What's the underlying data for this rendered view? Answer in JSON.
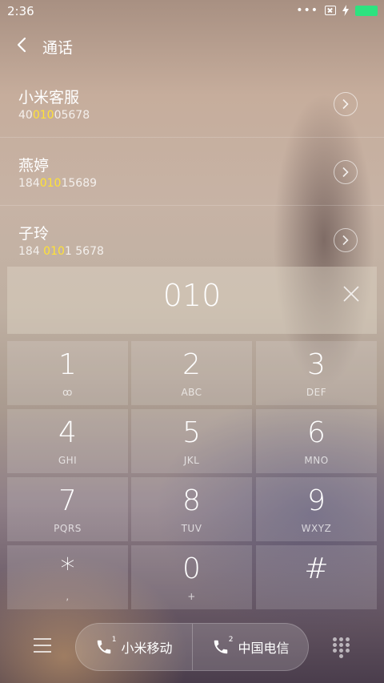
{
  "status": {
    "time": "2:36",
    "dots": "•••"
  },
  "header": {
    "title": "通话"
  },
  "results": [
    {
      "name": "小米客服",
      "number_pre": "40",
      "number_match": "010",
      "number_post": "05678"
    },
    {
      "name": "燕婷",
      "number_pre": "184",
      "number_match": "010",
      "number_post": "15689"
    },
    {
      "name": "子玲",
      "number_pre": "184 ",
      "number_match": "010",
      "number_post": "1 5678"
    }
  ],
  "dialer": {
    "input": "010"
  },
  "keys": [
    {
      "digit": "1",
      "letters": "ꝏ"
    },
    {
      "digit": "2",
      "letters": "ABC"
    },
    {
      "digit": "3",
      "letters": "DEF"
    },
    {
      "digit": "4",
      "letters": "GHI"
    },
    {
      "digit": "5",
      "letters": "JKL"
    },
    {
      "digit": "6",
      "letters": "MNO"
    },
    {
      "digit": "7",
      "letters": "PQRS"
    },
    {
      "digit": "8",
      "letters": "TUV"
    },
    {
      "digit": "9",
      "letters": "WXYZ"
    },
    {
      "digit": "*",
      "letters": ","
    },
    {
      "digit": "0",
      "letters": "+"
    },
    {
      "digit": "#",
      "letters": ""
    }
  ],
  "sims": [
    {
      "label": "小米移动",
      "slot": "1"
    },
    {
      "label": "中国电信",
      "slot": "2"
    }
  ],
  "colors": {
    "highlight": "#ffe236",
    "battery": "#2de27f"
  }
}
